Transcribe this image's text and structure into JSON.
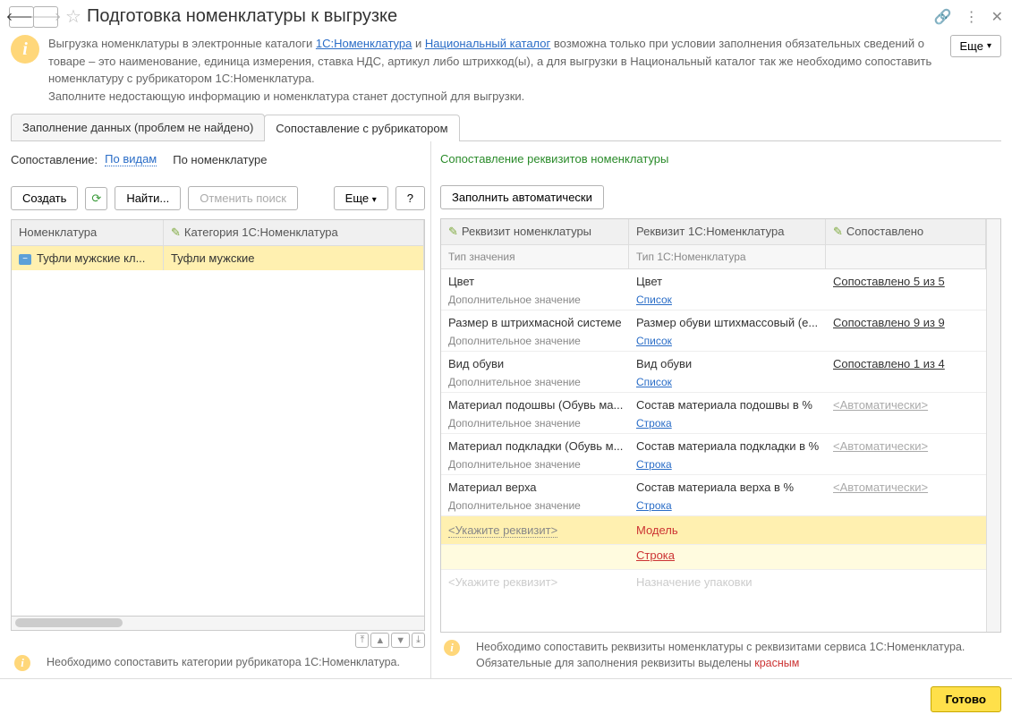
{
  "header": {
    "title": "Подготовка номенклатуры к выгрузке",
    "more_label": "Еще"
  },
  "info": {
    "text_part1": "Выгрузка номенклатуры в электронные каталоги ",
    "link1": "1С:Номенклатура",
    "text_part2": " и ",
    "link2": "Национальный каталог",
    "text_part3": " возможна только при условии заполнения обязательных сведений о товаре – это наименование, единица измерения, ставка НДС, артикул либо штрихкод(ы), а для выгрузки в Национальный каталог так же необходимо сопоставить номенклатуру с рубрикатором 1С:Номенклатура.",
    "text_part4": "Заполните недостающую информацию и номенклатура станет доступной для выгрузки."
  },
  "tabs": {
    "fill": "Заполнение данных (проблем не найдено)",
    "match": "Сопоставление с рубрикатором"
  },
  "left": {
    "compare_label": "Сопоставление:",
    "by_kinds": "По видам",
    "by_nomen": "По номенклатуре",
    "create": "Создать",
    "find": "Найти...",
    "cancel_search": "Отменить поиск",
    "more": "Еще",
    "help": "?",
    "th_nomen": "Номенклатура",
    "th_cat": "Категория 1С:Номенклатура",
    "row_nomen": "Туфли мужские кл...",
    "row_cat": "Туфли мужские",
    "footer": "Необходимо сопоставить категории рубрикатора 1С:Номенклатура."
  },
  "right": {
    "heading": "Сопоставление реквизитов номенклатуры",
    "fill_auto": "Заполнить автоматически",
    "th_rekv": "Реквизит номенклатуры",
    "th_rekv1c": "Реквизит 1С:Номенклатура",
    "th_sopos": "Сопоставлено",
    "sub_type": "Тип значения",
    "sub_type1c": "Тип 1С:Номенклатура",
    "dop": "Дополнительное значение",
    "list": "Список",
    "string": "Строка",
    "auto": "<Автоматически>",
    "specify": "<Укажите реквизит>",
    "rows": [
      {
        "name": "Цвет",
        "r1c": "Цвет",
        "sop": "Сопоставлено 5 из 5",
        "type": "list",
        "link": true
      },
      {
        "name": "Размер в штрихмасной системе",
        "r1c": "Размер обуви штихмассовый (е...",
        "sop": "Сопоставлено 9 из 9",
        "type": "list",
        "link": true
      },
      {
        "name": "Вид обуви",
        "r1c": "Вид обуви",
        "sop": "Сопоставлено 1 из 4",
        "type": "list",
        "link": true
      },
      {
        "name": "Материал подошвы (Обувь ма...",
        "r1c": "Состав материала подошвы в %",
        "sop": "auto",
        "type": "string"
      },
      {
        "name": "Материал подкладки (Обувь м...",
        "r1c": "Состав материала подкладки в %",
        "sop": "auto",
        "type": "string"
      },
      {
        "name": "Материал верха",
        "r1c": "Состав материала верха в %",
        "sop": "auto",
        "type": "string"
      }
    ],
    "model": "Модель",
    "half_row_left": "<Укажите реквизит>",
    "half_row_right": "Назначение упаковки",
    "footer_p1": "Необходимо сопоставить реквизиты номенклатуры с реквизитами сервиса 1С:Номенклатура. Обязательные для заполнения реквизиты выделены ",
    "footer_red": "красным"
  },
  "done": "Готово"
}
